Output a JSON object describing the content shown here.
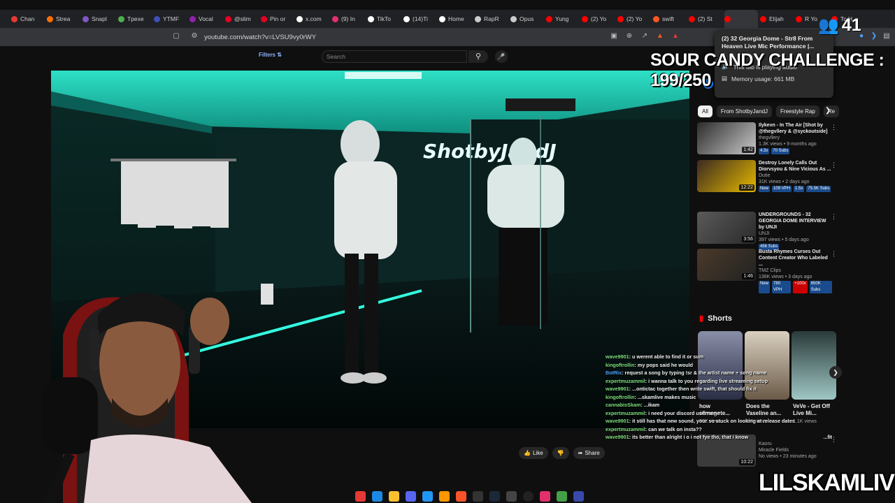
{
  "browser": {
    "tabs": [
      {
        "label": "Chan",
        "color": "#e53935"
      },
      {
        "label": "Strea",
        "color": "#ff6f00"
      },
      {
        "label": "Snapl",
        "color": "#7e57c2"
      },
      {
        "label": "Tpexe",
        "color": "#4caf50"
      },
      {
        "label": "YTMF",
        "color": "#3f51b5"
      },
      {
        "label": "Vocal",
        "color": "#8e24aa"
      },
      {
        "label": "@slim",
        "color": "#e60023"
      },
      {
        "label": "Pin or",
        "color": "#e60023"
      },
      {
        "label": "x.com",
        "color": "#ffffff"
      },
      {
        "label": "(9) In",
        "color": "#e1306c"
      },
      {
        "label": "TikTo",
        "color": "#ffffff"
      },
      {
        "label": "(14)Ti",
        "color": "#ffffff"
      },
      {
        "label": "Home",
        "color": "#ffffff"
      },
      {
        "label": "RapR",
        "color": "#cccccc"
      },
      {
        "label": "Opus",
        "color": "#cccccc"
      },
      {
        "label": "Yung",
        "color": "#ff0000"
      },
      {
        "label": "(2) Yo",
        "color": "#ff0000"
      },
      {
        "label": "(2) Yo",
        "color": "#ff0000"
      },
      {
        "label": "swift",
        "color": "#ff5722"
      },
      {
        "label": "(2) St",
        "color": "#ff0000"
      },
      {
        "label": "",
        "color": "#ff0000"
      },
      {
        "label": "Elijah",
        "color": "#ff0000"
      },
      {
        "label": "R Yo",
        "color": "#ff0000"
      },
      {
        "label": "Tc H",
        "color": "#ff0000"
      }
    ],
    "url": "youtube.com/watch?v=LVSU9vy0rWY"
  },
  "tooltip": {
    "title": "(2) 32 Georgia Dome - Str8 From Heaven Live Mic Performance |...",
    "audio": "This tab is playing audio",
    "memory": "Memory usage: 661 MB"
  },
  "youtube": {
    "filters": "Filters",
    "search_placeholder": "Search",
    "chips": [
      "All",
      "From ShotbyJandJ",
      "Freestyle Rap",
      "Re"
    ],
    "recs": [
      {
        "title": "Ilykevn - In The Air [Shot by @thegvllery & @syckoutside]",
        "channel": "thegvllery",
        "stats": "1.3K views • 9 months ago",
        "duration": "1:42",
        "badges": [
          "4.3x",
          "70 Subs"
        ]
      },
      {
        "title": "Destroy Lonely Calls Out Diorvsyou & Nine Vicious As ...",
        "channel": "Dutie",
        "stats": "31K views • 2 days ago",
        "duration": "12:22",
        "badges": [
          "New",
          "109 VPH",
          "1.5x",
          "75.5K Subs"
        ]
      },
      {
        "title": "UNDERGROUNDS - 32 GEORGIA DOME INTERVIEW by UNJI",
        "channel": "UNJI",
        "stats": "397 views • 5 days ago",
        "duration": "3:56",
        "badges": [
          "456 Subs"
        ]
      },
      {
        "title": "Busta Rhymes Curses Out Content Creator Who Labeled ...",
        "channel": "TMZ Clips",
        "stats": "136K views • 3 days ago",
        "duration": "1:46",
        "badges": [
          "New",
          "780 VPH",
          "+100x",
          "650K Subs"
        ]
      }
    ],
    "shorts_label": "Shorts",
    "shorts": [
      {
        "title": "how slimegote...",
        "views": "36K views"
      },
      {
        "title": "Does the Vaseline an...",
        "views": "1M views"
      },
      {
        "title": "VeVe - Get Off Live Mi...",
        "views": "1.1K views"
      }
    ],
    "rec5": {
      "title": "...fit",
      "channel": "Kaoru",
      "sub": "Miracle Fields",
      "stats": "No views • 23 minutes ago",
      "duration": "10:22"
    },
    "actions": {
      "like": "Like",
      "share": "Share"
    }
  },
  "video": {
    "sign_text": "ShotbyJandJ"
  },
  "stream": {
    "challenge": "SOUR CANDY CHALLENGE : 199/250",
    "viewers": "41",
    "brand": "LILSKAMLIVE"
  },
  "chat": [
    {
      "user": "wave9901",
      "text": ": u werent able to find it or sum"
    },
    {
      "user": "kingoftrollin",
      "text": ": my pops said he would"
    },
    {
      "user": "BotRix",
      "text": ": request a song by typing !sr & the artist name + song name",
      "bot": true
    },
    {
      "user": "expertmuzammil",
      "text": ": i wanna talk to you regarding live streaming setup"
    },
    {
      "user": "wave9901",
      "text": ": ...ontictac together then write swift, that should fix it"
    },
    {
      "user": "kingoftrollin",
      "text": ": ...skamlive makes music"
    },
    {
      "user": "cannabisSkam",
      "text": ": ...ikam"
    },
    {
      "user": "expertmuzammil",
      "text": ": i need your discord username"
    },
    {
      "user": "wave9901",
      "text": ": it still has that new sound, your so stuck on looking at release dates i..."
    },
    {
      "user": "expertmuzammil",
      "text": ": can we talk on insta??"
    },
    {
      "user": "wave9901",
      "text": ": its better than alright i o i not fye tho, that i know"
    }
  ]
}
